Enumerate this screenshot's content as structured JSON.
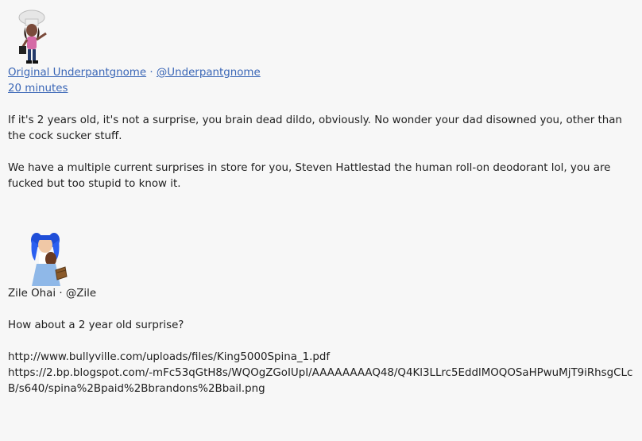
{
  "posts": [
    {
      "author_name": "Original Underpantgnome",
      "separator": "·",
      "handle": "@Underpantgnome",
      "time": "20 minutes",
      "paragraphs": [
        "If it's 2 years old, it's not a surprise, you brain dead dildo, obviously. No wonder your dad disowned you, other than the cock sucker stuff.",
        "We have a multiple current surprises in store for you, Steven Hattlestad the human roll-on deodorant lol, you are fucked but too stupid to know it."
      ]
    },
    {
      "author_name": "Zile Ohai",
      "separator": "·",
      "handle": "@Zile",
      "paragraphs": [
        "How about a 2 year old surprise?"
      ],
      "links": [
        "http://www.bullyville.com/uploads/files/King5000Spina_1.pdf",
        "https://2.bp.blogspot.com/-mFc53qGtH8s/WQOgZGoIUpI/AAAAAAAAQ48/Q4Kl3LLrc5EddlMOQOSaHPwuMjT9iRhsgCLcB/s640/spina%2Bpaid%2Bbrandons%2Bbail.png"
      ]
    }
  ]
}
